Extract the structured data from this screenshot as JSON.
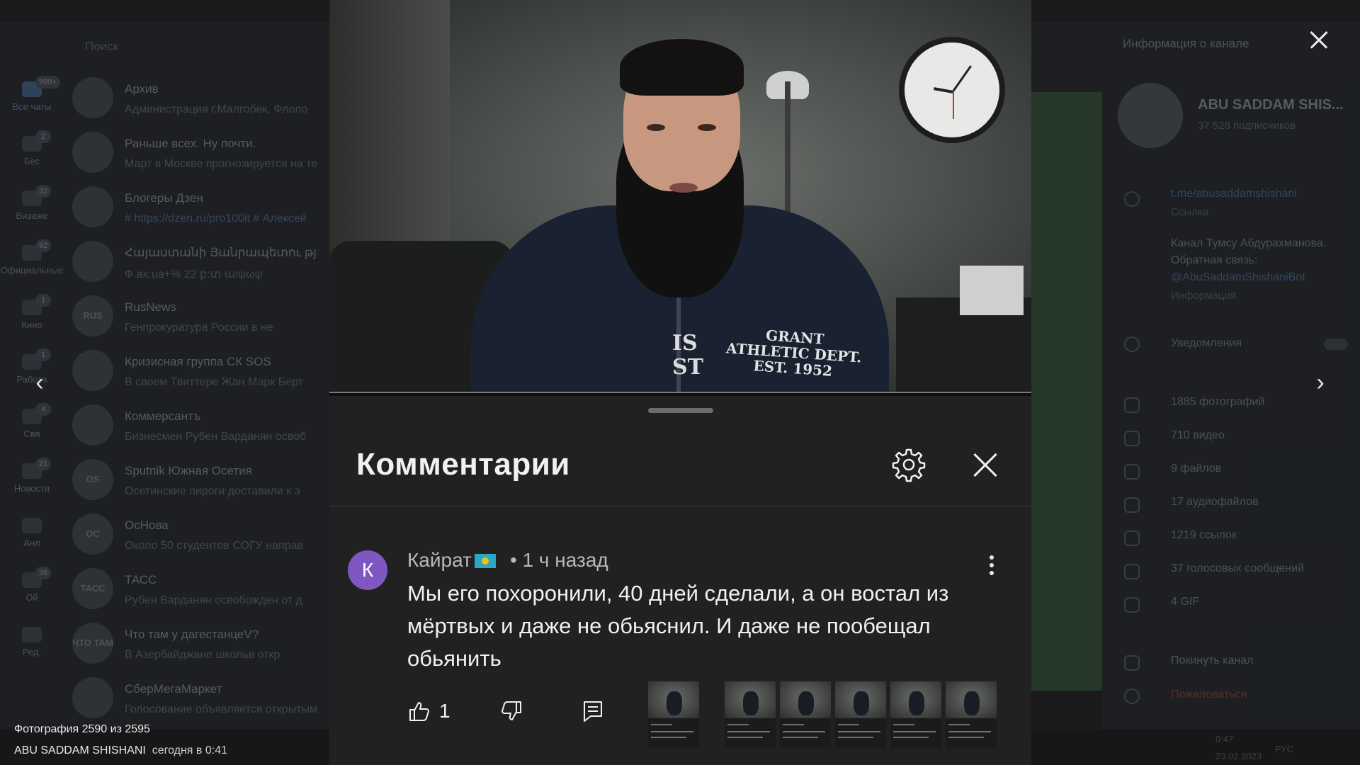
{
  "telegram": {
    "search_placeholder": "Поиск",
    "rail": [
      {
        "label": "Все чаты",
        "badge": "999+"
      },
      {
        "label": "Бес",
        "badge": "2"
      },
      {
        "label": "Визаже",
        "badge": "32"
      },
      {
        "label": "Официальные",
        "badge": "92"
      },
      {
        "label": "Кино",
        "badge": "1"
      },
      {
        "label": "Работа",
        "badge": "1"
      },
      {
        "label": "Свя",
        "badge": "4"
      },
      {
        "label": "Новости",
        "badge": "21"
      },
      {
        "label": "Анл",
        "badge": ""
      },
      {
        "label": "Ой",
        "badge": "36"
      },
      {
        "label": "Ред.",
        "badge": ""
      }
    ],
    "chats": [
      {
        "avatar": "",
        "name": "Архив",
        "preview": "Администрация г.Малгобек, Флоло"
      },
      {
        "avatar": "",
        "name": "Раньше всех. Ну почти.",
        "preview": "Март в Москве прогнозируется на те"
      },
      {
        "avatar": "",
        "name": "Блогеры Дзен",
        "preview": "# https://dzen.ru/pro100it # Алексей"
      },
      {
        "avatar": "",
        "name": "Հայաստանի Յանրապետու թյ",
        "preview": "Ф.ах.ua+% 22 բ:տ աιψωψ"
      },
      {
        "avatar": "RUS NEWS",
        "name": "RusNews",
        "preview": "Генпрокуратура России в не"
      },
      {
        "avatar": "",
        "name": "Кризисная группа СК SOS",
        "preview": "В своем Твиттере Жан Марк Берт"
      },
      {
        "avatar": "",
        "name": "Коммерсантъ",
        "preview": "Бизнесмен Рубен Варданян освоб"
      },
      {
        "avatar": "OS",
        "name": "Sputnik Южная Осетия",
        "preview": "Осетинские пироги доставили к э"
      },
      {
        "avatar": "OC",
        "name": "ОсНова",
        "preview": "Около 50 студентов СОГУ направ"
      },
      {
        "avatar": "ТАСС",
        "name": "ТАСС",
        "preview": "Рубен Варданян освобожден от д"
      },
      {
        "avatar": "ЧТО ТАМ",
        "name": "Что там у дагестанцеV?",
        "preview": "В Азербайджане школьв откр"
      },
      {
        "avatar": "",
        "name": "СберМегаМаркет",
        "preview": "Голосование объявляется открытым"
      }
    ]
  },
  "channel_panel": {
    "title": "Информация о канале",
    "name": "ABU SADDAM SHIS...",
    "subscribers": "37 528 подписчиков",
    "link": "t.me/abusaddamshishani",
    "link_label": "Ссылка",
    "description_line1": "Канал Тумсу Абдурахманова.",
    "description_line2": "Обратная связь:",
    "bot_link": "@AbuSaddamShishaniBot",
    "description_label": "Информация",
    "notifications": "Уведомления",
    "media": [
      "1885 фотографий",
      "710 видео",
      "9 файлов",
      "17 аудиофайлов",
      "1219 ссылок",
      "37 голосовых сообщений",
      "4 GIF"
    ],
    "leave": "Покинуть канал",
    "report": "Пожаловаться"
  },
  "taskbar": {
    "lang": "РУС",
    "time": "0:47",
    "date": "23.02.2023"
  },
  "viewer": {
    "photo_counter": "Фотография 2590 из 2595",
    "author": "ABU SADDAM SHISHANI",
    "timestamp": "сегодня в 0:41"
  },
  "video": {
    "hoodie_isst": "IS\nST",
    "hoodie_text": "GRANT\nATHLETIC DEPT.\nEST. 1952"
  },
  "comments": {
    "title": "Комментарии",
    "author": "Кайрат",
    "meta": "• 1 ч назад",
    "avatar_letter": "К",
    "text": "Мы его похоронили, 40 дней сделали, а он востал из мёртвых и даже не обьяснил. И даже не пообещал обьянить",
    "like_count": "1",
    "thumbnail_count": 6
  }
}
